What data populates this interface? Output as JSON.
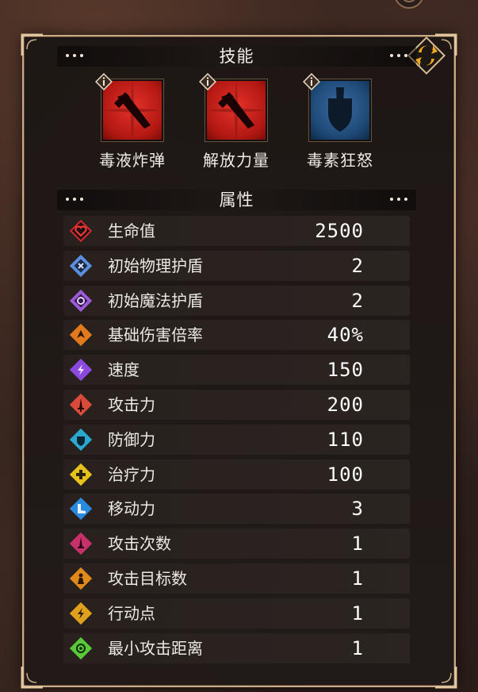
{
  "sections": {
    "skills_title": "技能",
    "attributes_title": "属性"
  },
  "skills": [
    {
      "name": "毒液炸弹",
      "icon": "red-dagger-skill-icon",
      "color": "#c0201c"
    },
    {
      "name": "解放力量",
      "icon": "red-dagger-skill-icon",
      "color": "#c0201c"
    },
    {
      "name": "毒素狂怒",
      "icon": "blue-shield-dagger-icon",
      "color": "#1f4a78"
    }
  ],
  "attributes": [
    {
      "label": "生命值",
      "value": "2500",
      "icon": "heart-icon",
      "color": "#d8262c"
    },
    {
      "label": "初始物理护盾",
      "value": "2",
      "icon": "physical-shield-icon",
      "color": "#5b8fe0"
    },
    {
      "label": "初始魔法护盾",
      "value": "2",
      "icon": "magic-shield-icon",
      "color": "#9c5ad8"
    },
    {
      "label": "基础伤害倍率",
      "value": "40%",
      "icon": "damage-multiplier-icon",
      "color": "#e07a1c"
    },
    {
      "label": "速度",
      "value": "150",
      "icon": "speed-icon",
      "color": "#8a4ae0"
    },
    {
      "label": "攻击力",
      "value": "200",
      "icon": "attack-icon",
      "color": "#d84a3a"
    },
    {
      "label": "防御力",
      "value": "110",
      "icon": "defense-icon",
      "color": "#2aa8d0"
    },
    {
      "label": "治疗力",
      "value": "100",
      "icon": "heal-icon",
      "color": "#e8c21c"
    },
    {
      "label": "移动力",
      "value": "3",
      "icon": "move-icon",
      "color": "#2a8ae0"
    },
    {
      "label": "攻击次数",
      "value": "1",
      "icon": "attack-count-icon",
      "color": "#c8306a"
    },
    {
      "label": "攻击目标数",
      "value": "1",
      "icon": "target-count-icon",
      "color": "#e08a1c"
    },
    {
      "label": "行动点",
      "value": "1",
      "icon": "action-point-icon",
      "color": "#e0a01c"
    },
    {
      "label": "最小攻击距离",
      "value": "1",
      "icon": "min-range-icon",
      "color": "#5ac83a"
    }
  ]
}
